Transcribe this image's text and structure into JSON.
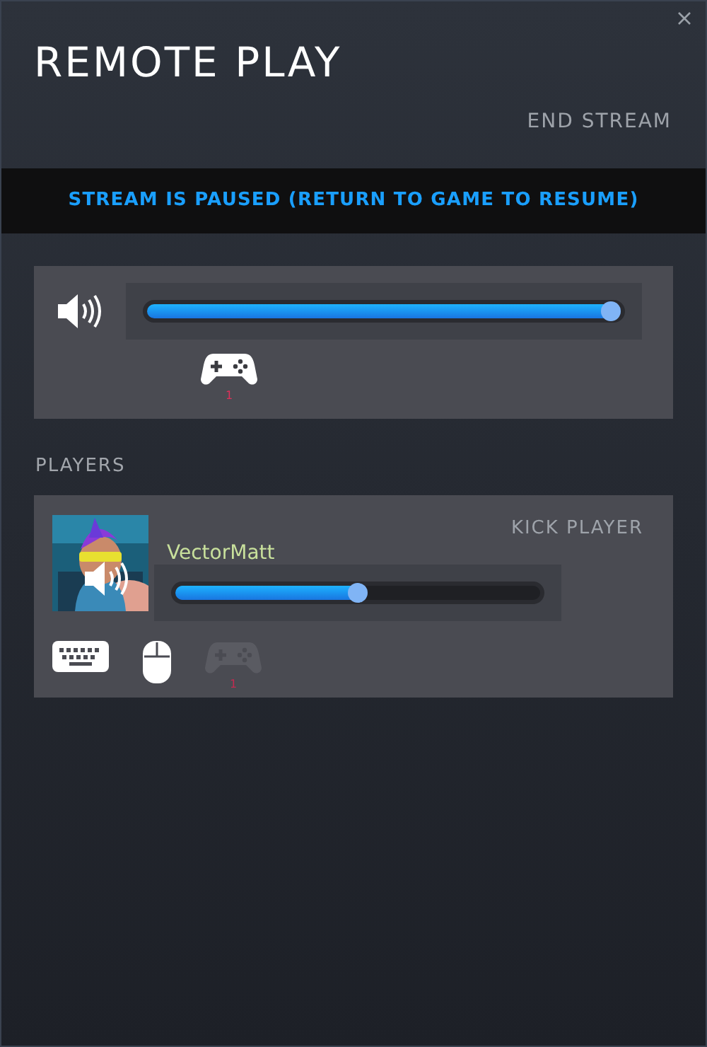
{
  "window": {
    "title": "REMOTE PLAY"
  },
  "end_stream": "END STREAM",
  "banner": "STREAM IS PAUSED (RETURN TO GAME TO RESUME)",
  "host": {
    "volume": {
      "level": 0.98
    },
    "devices": [
      {
        "kind": "controller",
        "enabled": true,
        "number": "1"
      }
    ]
  },
  "players_heading": "PLAYERS",
  "players": [
    {
      "name": "VectorMatt",
      "kick": "KICK PLAYER",
      "volume": {
        "level": 0.5
      },
      "devices": [
        {
          "kind": "keyboard",
          "enabled": true
        },
        {
          "kind": "mouse",
          "enabled": true
        },
        {
          "kind": "controller",
          "enabled": false,
          "number": "1"
        }
      ]
    }
  ]
}
